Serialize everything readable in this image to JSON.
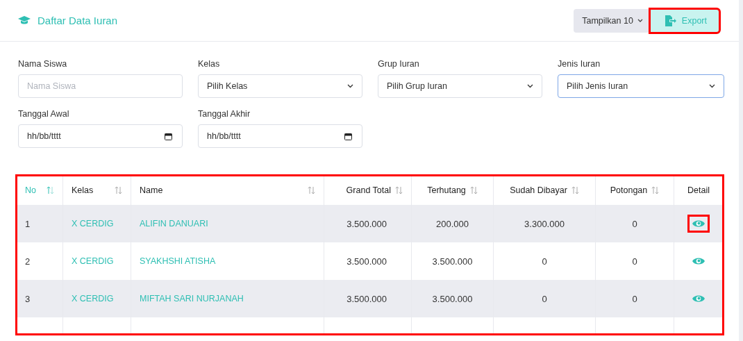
{
  "header": {
    "title": "Daftar Data Iuran",
    "page_size": {
      "label": "Tampilkan 10"
    },
    "export": {
      "label": "Export",
      "highlighted": true
    }
  },
  "filters": [
    {
      "label": "Nama Siswa",
      "kind": "text",
      "placeholder": "Nama Siswa"
    },
    {
      "label": "Kelas",
      "kind": "select",
      "value": "Pilih Kelas",
      "focused": false
    },
    {
      "label": "Grup Iuran",
      "kind": "select",
      "value": "Pilih Grup Iuran",
      "focused": false
    },
    {
      "label": "Jenis Iuran",
      "kind": "select",
      "value": "Pilih Jenis Iuran",
      "focused": true
    },
    {
      "label": "Tanggal Awal",
      "kind": "date",
      "value": "hh/bb/tttt"
    },
    {
      "label": "Tanggal Akhir",
      "kind": "date",
      "value": "hh/bb/tttt"
    }
  ],
  "table": {
    "highlighted": true,
    "columns": [
      {
        "label": "No",
        "sortable": true,
        "sorted": true
      },
      {
        "label": "Kelas",
        "sortable": true,
        "sorted": false
      },
      {
        "label": "Name",
        "sortable": true,
        "sorted": false
      },
      {
        "label": "Grand Total",
        "sortable": true,
        "sorted": false
      },
      {
        "label": "Terhutang",
        "sortable": true,
        "sorted": false
      },
      {
        "label": "Sudah Dibayar",
        "sortable": true,
        "sorted": false
      },
      {
        "label": "Potongan",
        "sortable": true,
        "sorted": false
      },
      {
        "label": "Detail",
        "sortable": false
      }
    ],
    "rows": [
      {
        "no": "1",
        "kelas": "X CERDIG",
        "name": "ALIFIN DANUARI",
        "grand_total": "3.500.000",
        "terhutang": "200.000",
        "sudah_dibayar": "3.300.000",
        "potongan": "0",
        "detail_highlighted": true
      },
      {
        "no": "2",
        "kelas": "X CERDIG",
        "name": "SYAKHSHI ATISHA",
        "grand_total": "3.500.000",
        "terhutang": "3.500.000",
        "sudah_dibayar": "0",
        "potongan": "0",
        "detail_highlighted": false
      },
      {
        "no": "3",
        "kelas": "X CERDIG",
        "name": "MIFTAH SARI NURJANAH",
        "grand_total": "3.500.000",
        "terhutang": "3.500.000",
        "sudah_dibayar": "0",
        "potongan": "0",
        "detail_highlighted": false
      }
    ]
  }
}
